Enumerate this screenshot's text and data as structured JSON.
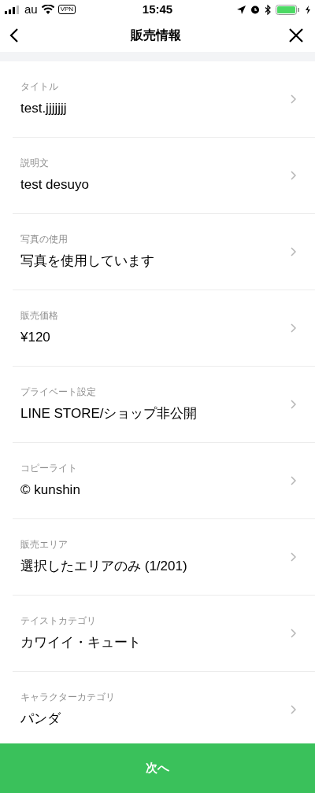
{
  "status_bar": {
    "carrier": "au",
    "vpn": "VPN",
    "time": "15:45"
  },
  "nav": {
    "title": "販売情報"
  },
  "items": [
    {
      "label": "タイトル",
      "value": "test.jjjjjjj"
    },
    {
      "label": "説明文",
      "value": "test desuyo"
    },
    {
      "label": "写真の使用",
      "value": "写真を使用しています"
    },
    {
      "label": "販売価格",
      "value": "¥120"
    },
    {
      "label": "プライベート設定",
      "value": "LINE STORE/ショップ非公開"
    },
    {
      "label": "コピーライト",
      "value": "© kunshin"
    },
    {
      "label": "販売エリア",
      "value": "選択したエリアのみ (1/201)"
    },
    {
      "label": "テイストカテゴリ",
      "value": "カワイイ・キュート"
    },
    {
      "label": "キャラクターカテゴリ",
      "value": "パンダ"
    }
  ],
  "next_button": "次へ"
}
